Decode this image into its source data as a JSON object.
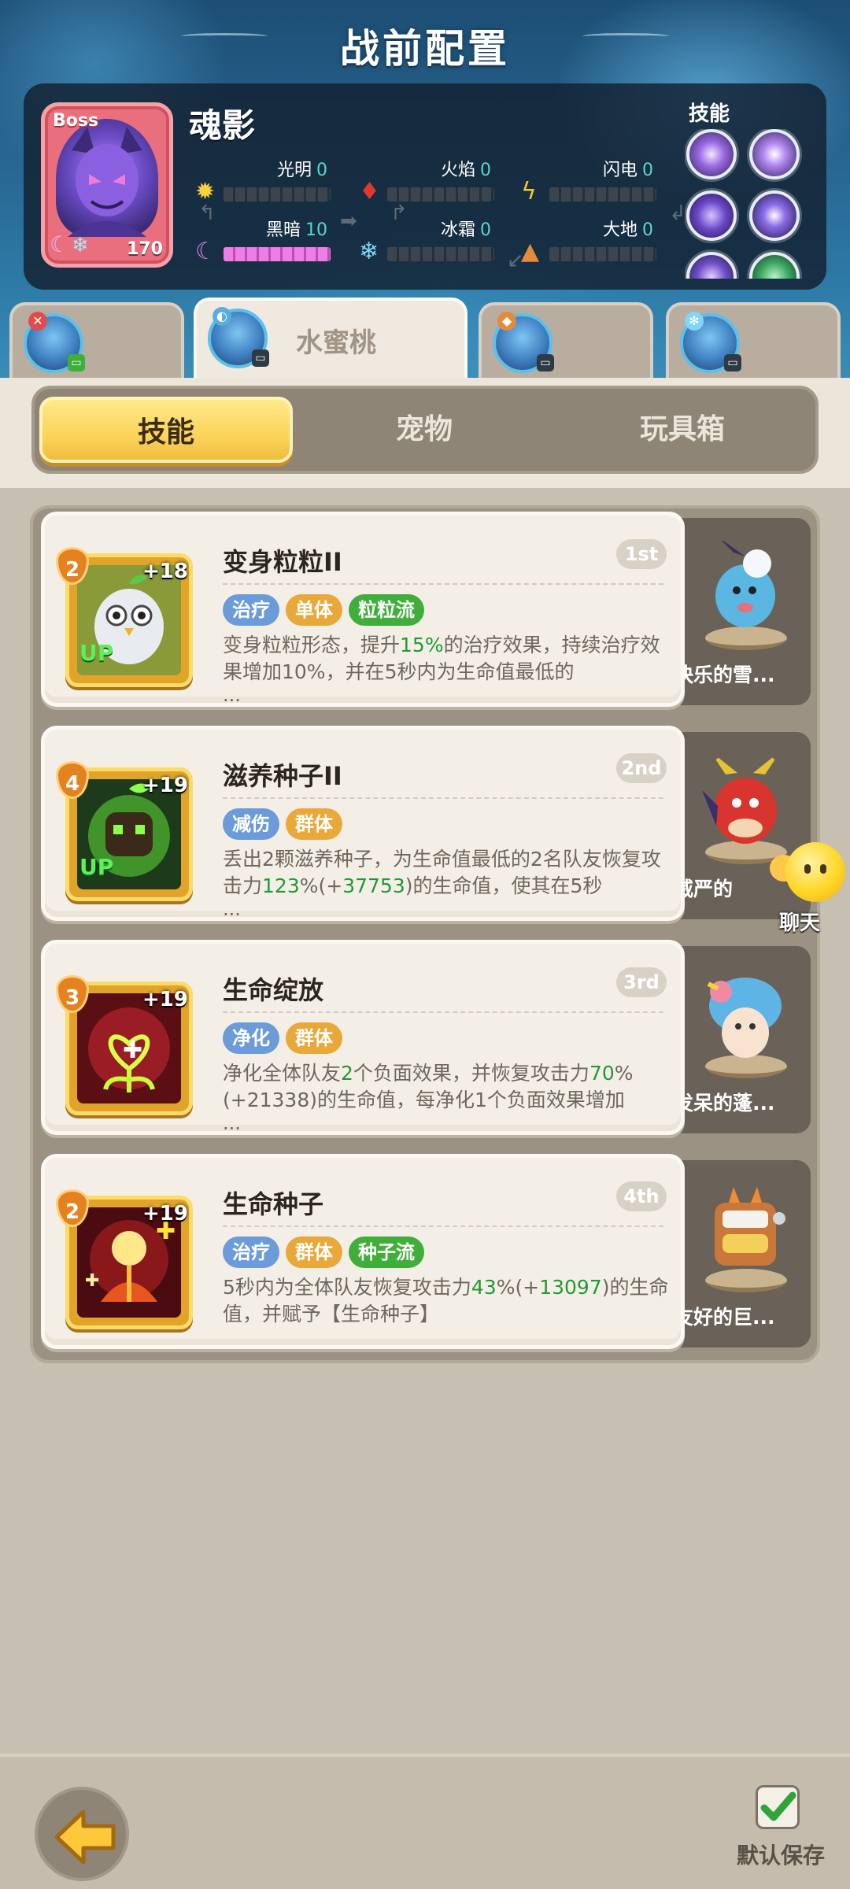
{
  "header": {
    "title": "战前配置"
  },
  "boss": {
    "tag": "Boss",
    "name": "魂影",
    "level": "170",
    "skills_label": "技能",
    "stats": [
      {
        "label": "光明",
        "value": "0",
        "icon": "sun-icon",
        "fill_percent": 0
      },
      {
        "label": "火焰",
        "value": "0",
        "icon": "fire-icon",
        "fill_percent": 0
      },
      {
        "label": "闪电",
        "value": "0",
        "icon": "lightning-icon",
        "fill_percent": 0
      },
      {
        "label": "黑暗",
        "value": "10",
        "icon": "moon-icon",
        "fill_percent": 100
      },
      {
        "label": "冰霜",
        "value": "0",
        "icon": "snowflake-icon",
        "fill_percent": 0
      },
      {
        "label": "大地",
        "value": "0",
        "icon": "earth-icon",
        "fill_percent": 0
      }
    ]
  },
  "heroes": [
    {
      "name": "",
      "active": false
    },
    {
      "name": "水蜜桃",
      "active": true
    },
    {
      "name": "",
      "active": false
    },
    {
      "name": "",
      "active": false
    }
  ],
  "tabs": [
    {
      "label": "技能",
      "active": true
    },
    {
      "label": "宠物",
      "active": false
    },
    {
      "label": "玩具箱",
      "active": false
    }
  ],
  "skills": [
    {
      "level": "2",
      "bonus": "+18",
      "up": "UP",
      "name": "变身粒粒II",
      "rank": "1st",
      "tags": [
        {
          "text": "治疗",
          "color": "#6b9bd8"
        },
        {
          "text": "单体",
          "color": "#e9a83a"
        },
        {
          "text": "粒粒流",
          "color": "#3fae3a"
        }
      ],
      "desc_1": "变身粒粒形态，提升",
      "desc_h1": "15%",
      "desc_2": "的治疗效果，持续治疗效果增加10%，并在5秒内为生命值最低的",
      "desc_h2": "",
      "desc_3": "",
      "ellipsis": "...",
      "pet_name": "快乐的雪..."
    },
    {
      "level": "4",
      "bonus": "+19",
      "up": "UP",
      "name": "滋养种子II",
      "rank": "2nd",
      "tags": [
        {
          "text": "减伤",
          "color": "#6b9bd8"
        },
        {
          "text": "群体",
          "color": "#e9a83a"
        }
      ],
      "desc_1": "丢出2颗滋养种子，为生命值最低的2名队友恢复攻击力",
      "desc_h1": "123",
      "desc_2": "%(+",
      "desc_h2": "37753",
      "desc_3": ")的生命值，使其在5秒",
      "ellipsis": "...",
      "pet_name": "威严的"
    },
    {
      "level": "3",
      "bonus": "+19",
      "up": "",
      "name": "生命绽放",
      "rank": "3rd",
      "tags": [
        {
          "text": "净化",
          "color": "#6b9bd8"
        },
        {
          "text": "群体",
          "color": "#e9a83a"
        }
      ],
      "desc_1": "净化全体队友",
      "desc_h1": "2",
      "desc_2": "个负面效果，并恢复攻击力",
      "desc_h2": "70",
      "desc_3": "%(+21338)的生命值，每净化1个负面效果增加",
      "ellipsis": "...",
      "pet_name": "发呆的蓬..."
    },
    {
      "level": "2",
      "bonus": "+19",
      "up": "",
      "name": "生命种子",
      "rank": "4th",
      "tags": [
        {
          "text": "治疗",
          "color": "#6b9bd8"
        },
        {
          "text": "群体",
          "color": "#e9a83a"
        },
        {
          "text": "种子流",
          "color": "#3fae3a"
        }
      ],
      "desc_1": "5秒内为全体队友恢复攻击力",
      "desc_h1": "43",
      "desc_2": "%(+",
      "desc_h2": "13097",
      "desc_3": ")的生命值，并赋予【生命种子】",
      "ellipsis": "",
      "pet_name": "友好的巨..."
    }
  ],
  "chat": {
    "label": "聊天"
  },
  "footer": {
    "save_label": "默认保存"
  }
}
